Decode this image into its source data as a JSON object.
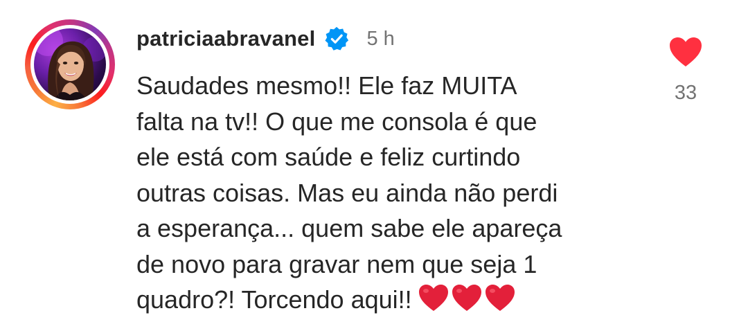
{
  "comment": {
    "username": "patriciaabravanel",
    "verified": true,
    "timestamp": "5 h",
    "text_lines": [
      "Saudades mesmo!! Ele faz MUITA",
      "falta na tv!! O que me consola é que",
      "ele está com saúde e feliz curtindo",
      "outras coisas. Mas eu ainda não perdi",
      "a esperança... quem sabe ele apareça",
      "de novo para gravar nem que seja 1",
      "quadro?! Torcendo aqui!!"
    ],
    "emoji": [
      "❤️",
      "❤️",
      "❤️"
    ],
    "like_count": "33",
    "liked": true
  },
  "icons": {
    "verified": "verified-badge-icon",
    "like": "heart-filled-icon"
  },
  "colors": {
    "text": "#262626",
    "muted": "#737373",
    "like_red": "#ff3040",
    "verified_blue": "#0095f6",
    "emoji_heart": "#e3203a"
  }
}
